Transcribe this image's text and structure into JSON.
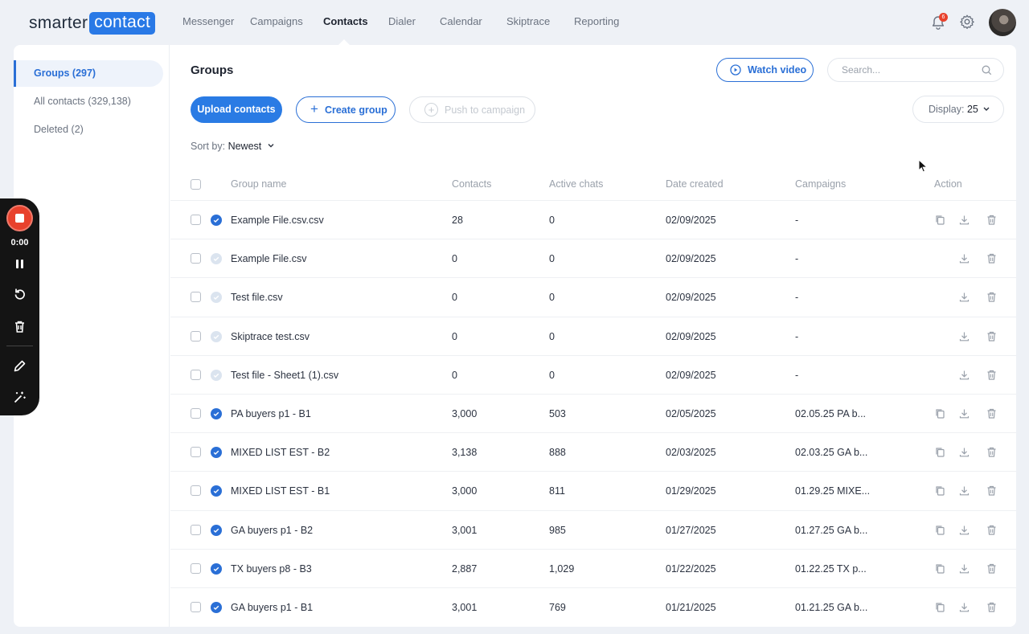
{
  "logo": {
    "part1": "smarter",
    "part2": "contact"
  },
  "nav": {
    "items": [
      "Messenger",
      "Campaigns",
      "Contacts",
      "Dialer",
      "Calendar",
      "Skiptrace",
      "Reporting"
    ],
    "active": "Contacts",
    "notification_count": "6"
  },
  "sidebar": {
    "items": [
      {
        "label": "Groups (297)",
        "active": true
      },
      {
        "label": "All contacts (329,138)",
        "active": false
      },
      {
        "label": "Deleted (2)",
        "active": false
      }
    ]
  },
  "header": {
    "title": "Groups",
    "watch_video": "Watch video",
    "search_placeholder": "Search..."
  },
  "toolbar": {
    "upload": "Upload contacts",
    "create": "Create group",
    "push": "Push to campaign",
    "display_label": "Display:",
    "display_value": "25",
    "sort_label": "Sort by:",
    "sort_value": "Newest"
  },
  "table": {
    "columns": [
      "Group name",
      "Contacts",
      "Active chats",
      "Date created",
      "Campaigns",
      "Action"
    ],
    "rows": [
      {
        "name": "Example File.csv.csv",
        "contacts": "28",
        "chats": "0",
        "date": "02/09/2025",
        "campaigns": "-",
        "status": "on",
        "copy": true
      },
      {
        "name": "Example File.csv",
        "contacts": "0",
        "chats": "0",
        "date": "02/09/2025",
        "campaigns": "-",
        "status": "off",
        "copy": false
      },
      {
        "name": "Test file.csv",
        "contacts": "0",
        "chats": "0",
        "date": "02/09/2025",
        "campaigns": "-",
        "status": "off",
        "copy": false
      },
      {
        "name": "Skiptrace test.csv",
        "contacts": "0",
        "chats": "0",
        "date": "02/09/2025",
        "campaigns": "-",
        "status": "off",
        "copy": false
      },
      {
        "name": "Test file - Sheet1 (1).csv",
        "contacts": "0",
        "chats": "0",
        "date": "02/09/2025",
        "campaigns": "-",
        "status": "off",
        "copy": false
      },
      {
        "name": "PA buyers p1 - B1",
        "contacts": "3,000",
        "chats": "503",
        "date": "02/05/2025",
        "campaigns": "02.05.25 PA b...",
        "status": "on",
        "copy": true
      },
      {
        "name": "MIXED LIST EST - B2",
        "contacts": "3,138",
        "chats": "888",
        "date": "02/03/2025",
        "campaigns": "02.03.25 GA b...",
        "status": "on",
        "copy": true
      },
      {
        "name": "MIXED LIST EST - B1",
        "contacts": "3,000",
        "chats": "811",
        "date": "01/29/2025",
        "campaigns": "01.29.25 MIXE...",
        "status": "on",
        "copy": true
      },
      {
        "name": "GA buyers p1 - B2",
        "contacts": "3,001",
        "chats": "985",
        "date": "01/27/2025",
        "campaigns": "01.27.25 GA b...",
        "status": "on",
        "copy": true
      },
      {
        "name": "TX buyers p8 - B3",
        "contacts": "2,887",
        "chats": "1,029",
        "date": "01/22/2025",
        "campaigns": "01.22.25 TX p...",
        "status": "on",
        "copy": true
      },
      {
        "name": "GA buyers p1 - B1",
        "contacts": "3,001",
        "chats": "769",
        "date": "01/21/2025",
        "campaigns": "01.21.25 GA b...",
        "status": "on",
        "copy": true
      }
    ]
  },
  "recorder": {
    "time": "0:00"
  },
  "colors": {
    "accent": "#2a6fd6",
    "record": "#e8412c"
  }
}
